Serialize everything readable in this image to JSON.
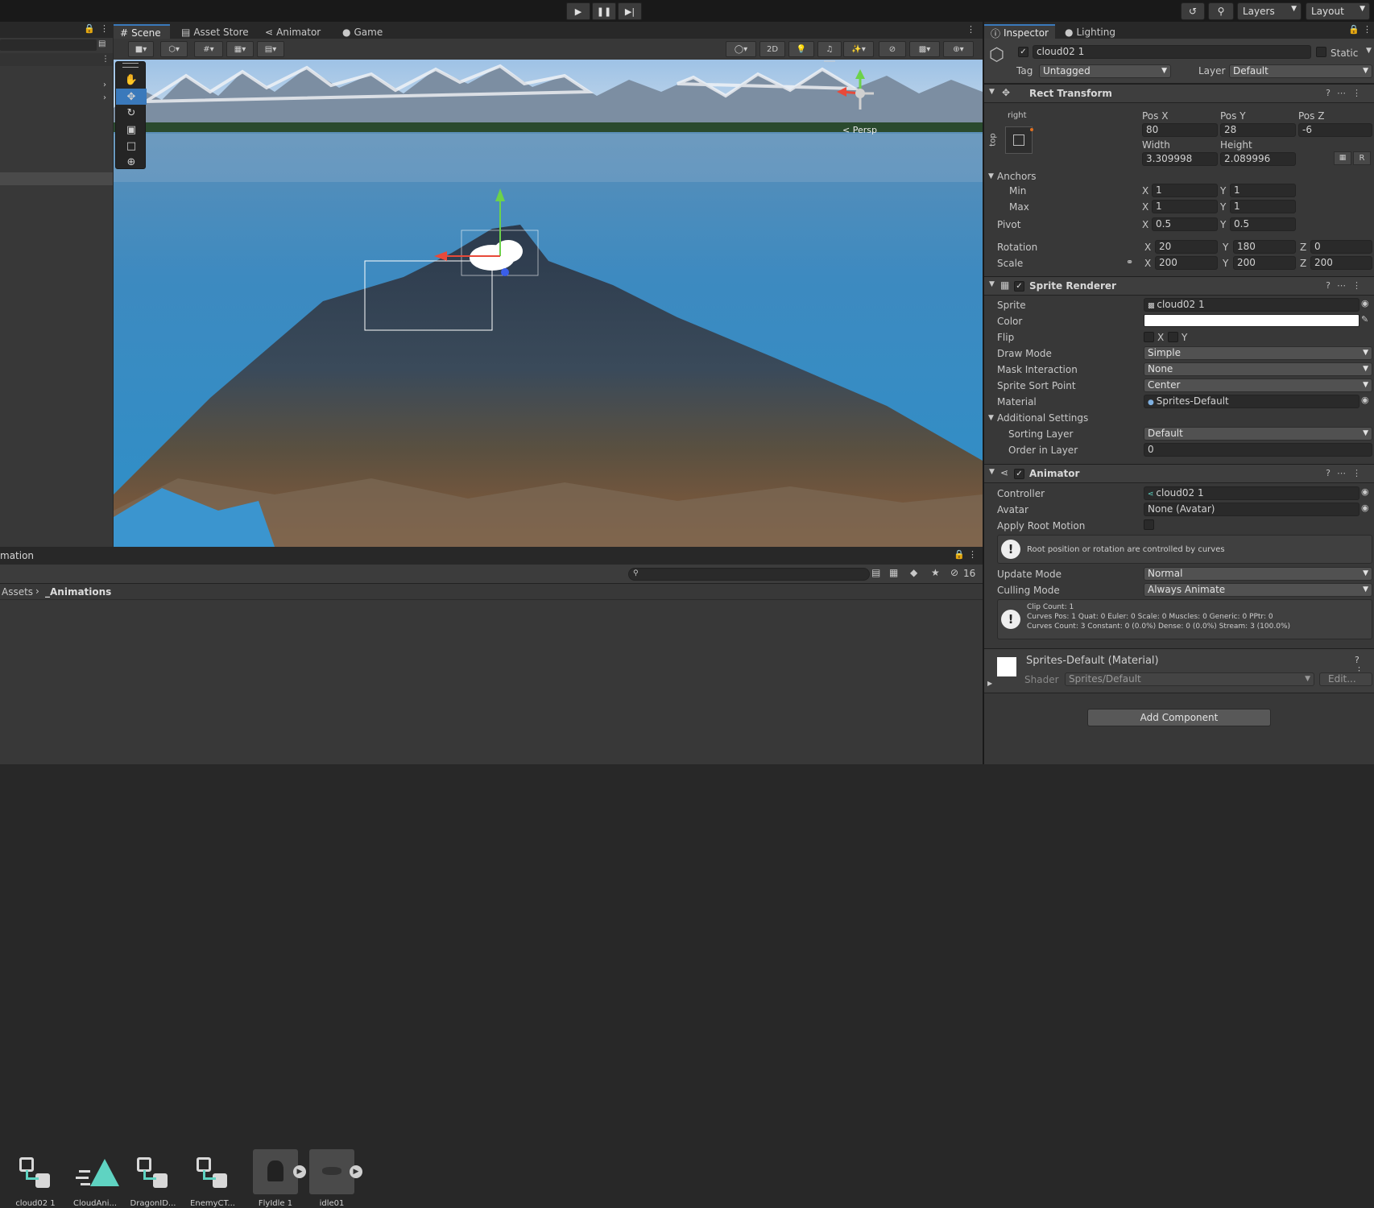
{
  "toolbar": {
    "layers": "Layers",
    "layout": "Layout"
  },
  "scene_tabs": [
    {
      "label": "Scene"
    },
    {
      "label": "Asset Store"
    },
    {
      "label": "Animator"
    },
    {
      "label": "Game"
    }
  ],
  "scene_toolbar": {
    "mode2d": "2D",
    "hidden_count": "16"
  },
  "gizmo": {
    "persp": "< Persp"
  },
  "inspector_tabs": [
    {
      "label": "Inspector"
    },
    {
      "label": "Lighting"
    }
  ],
  "object": {
    "name": "cloud02 1",
    "static_label": "Static",
    "tag_label": "Tag",
    "tag": "Untagged",
    "layer_label": "Layer",
    "layer": "Default"
  },
  "rect_transform": {
    "title": "Rect Transform",
    "anchor_h": "right",
    "anchor_v": "top",
    "pos_x_label": "Pos X",
    "pos_y_label": "Pos Y",
    "pos_z_label": "Pos Z",
    "pos_x": "80",
    "pos_y": "28",
    "pos_z": "-6",
    "width_label": "Width",
    "height_label": "Height",
    "width": "3.309998",
    "height": "2.089996",
    "r_button": "R",
    "anchors_label": "Anchors",
    "min_label": "Min",
    "max_label": "Max",
    "min_x": "1",
    "min_y": "1",
    "max_x": "1",
    "max_y": "1",
    "pivot_label": "Pivot",
    "pivot_x": "0.5",
    "pivot_y": "0.5",
    "rotation_label": "Rotation",
    "rot_x": "20",
    "rot_y": "180",
    "rot_z": "0",
    "scale_label": "Scale",
    "scale_x": "200",
    "scale_y": "200",
    "scale_z": "200",
    "x": "X",
    "y": "Y",
    "z": "Z"
  },
  "sprite_renderer": {
    "title": "Sprite Renderer",
    "sprite_label": "Sprite",
    "sprite": "cloud02 1",
    "color_label": "Color",
    "flip_label": "Flip",
    "flip_x": "X",
    "flip_y": "Y",
    "draw_mode_label": "Draw Mode",
    "draw_mode": "Simple",
    "mask_label": "Mask Interaction",
    "mask": "None",
    "sort_point_label": "Sprite Sort Point",
    "sort_point": "Center",
    "material_label": "Material",
    "material": "Sprites-Default",
    "additional_label": "Additional Settings",
    "sorting_layer_label": "Sorting Layer",
    "sorting_layer": "Default",
    "order_label": "Order in Layer",
    "order": "0"
  },
  "animator": {
    "title": "Animator",
    "controller_label": "Controller",
    "controller": "cloud02 1",
    "avatar_label": "Avatar",
    "avatar": "None (Avatar)",
    "root_motion_label": "Apply Root Motion",
    "root_msg": "Root position or rotation are controlled by curves",
    "update_label": "Update Mode",
    "update": "Normal",
    "culling_label": "Culling Mode",
    "culling": "Always Animate",
    "info1": "Clip Count: 1",
    "info2": "Curves Pos: 1 Quat: 0 Euler: 0 Scale: 0 Muscles: 0 Generic: 0 PPtr: 0",
    "info3": "Curves Count: 3 Constant: 0 (0.0%) Dense: 0 (0.0%) Stream: 3 (100.0%)"
  },
  "material": {
    "title": "Sprites-Default (Material)",
    "shader_label": "Shader",
    "shader": "Sprites/Default",
    "edit": "Edit..."
  },
  "add_component": "Add Component",
  "project": {
    "tab": "mation",
    "breadcrumb_root": "Assets",
    "breadcrumb_folder": "_Animations",
    "assets": [
      {
        "name": "cloud02 1",
        "kind": "controller"
      },
      {
        "name": "CloudAni...",
        "kind": "animation"
      },
      {
        "name": "DragonID...",
        "kind": "controller"
      },
      {
        "name": "EnemyCT...",
        "kind": "controller"
      },
      {
        "name": "FlyIdle 1",
        "kind": "model"
      },
      {
        "name": "idle01",
        "kind": "model"
      }
    ]
  },
  "colors": {
    "accent": "#3a79bb",
    "controller_icon": "#5fd3c2"
  }
}
